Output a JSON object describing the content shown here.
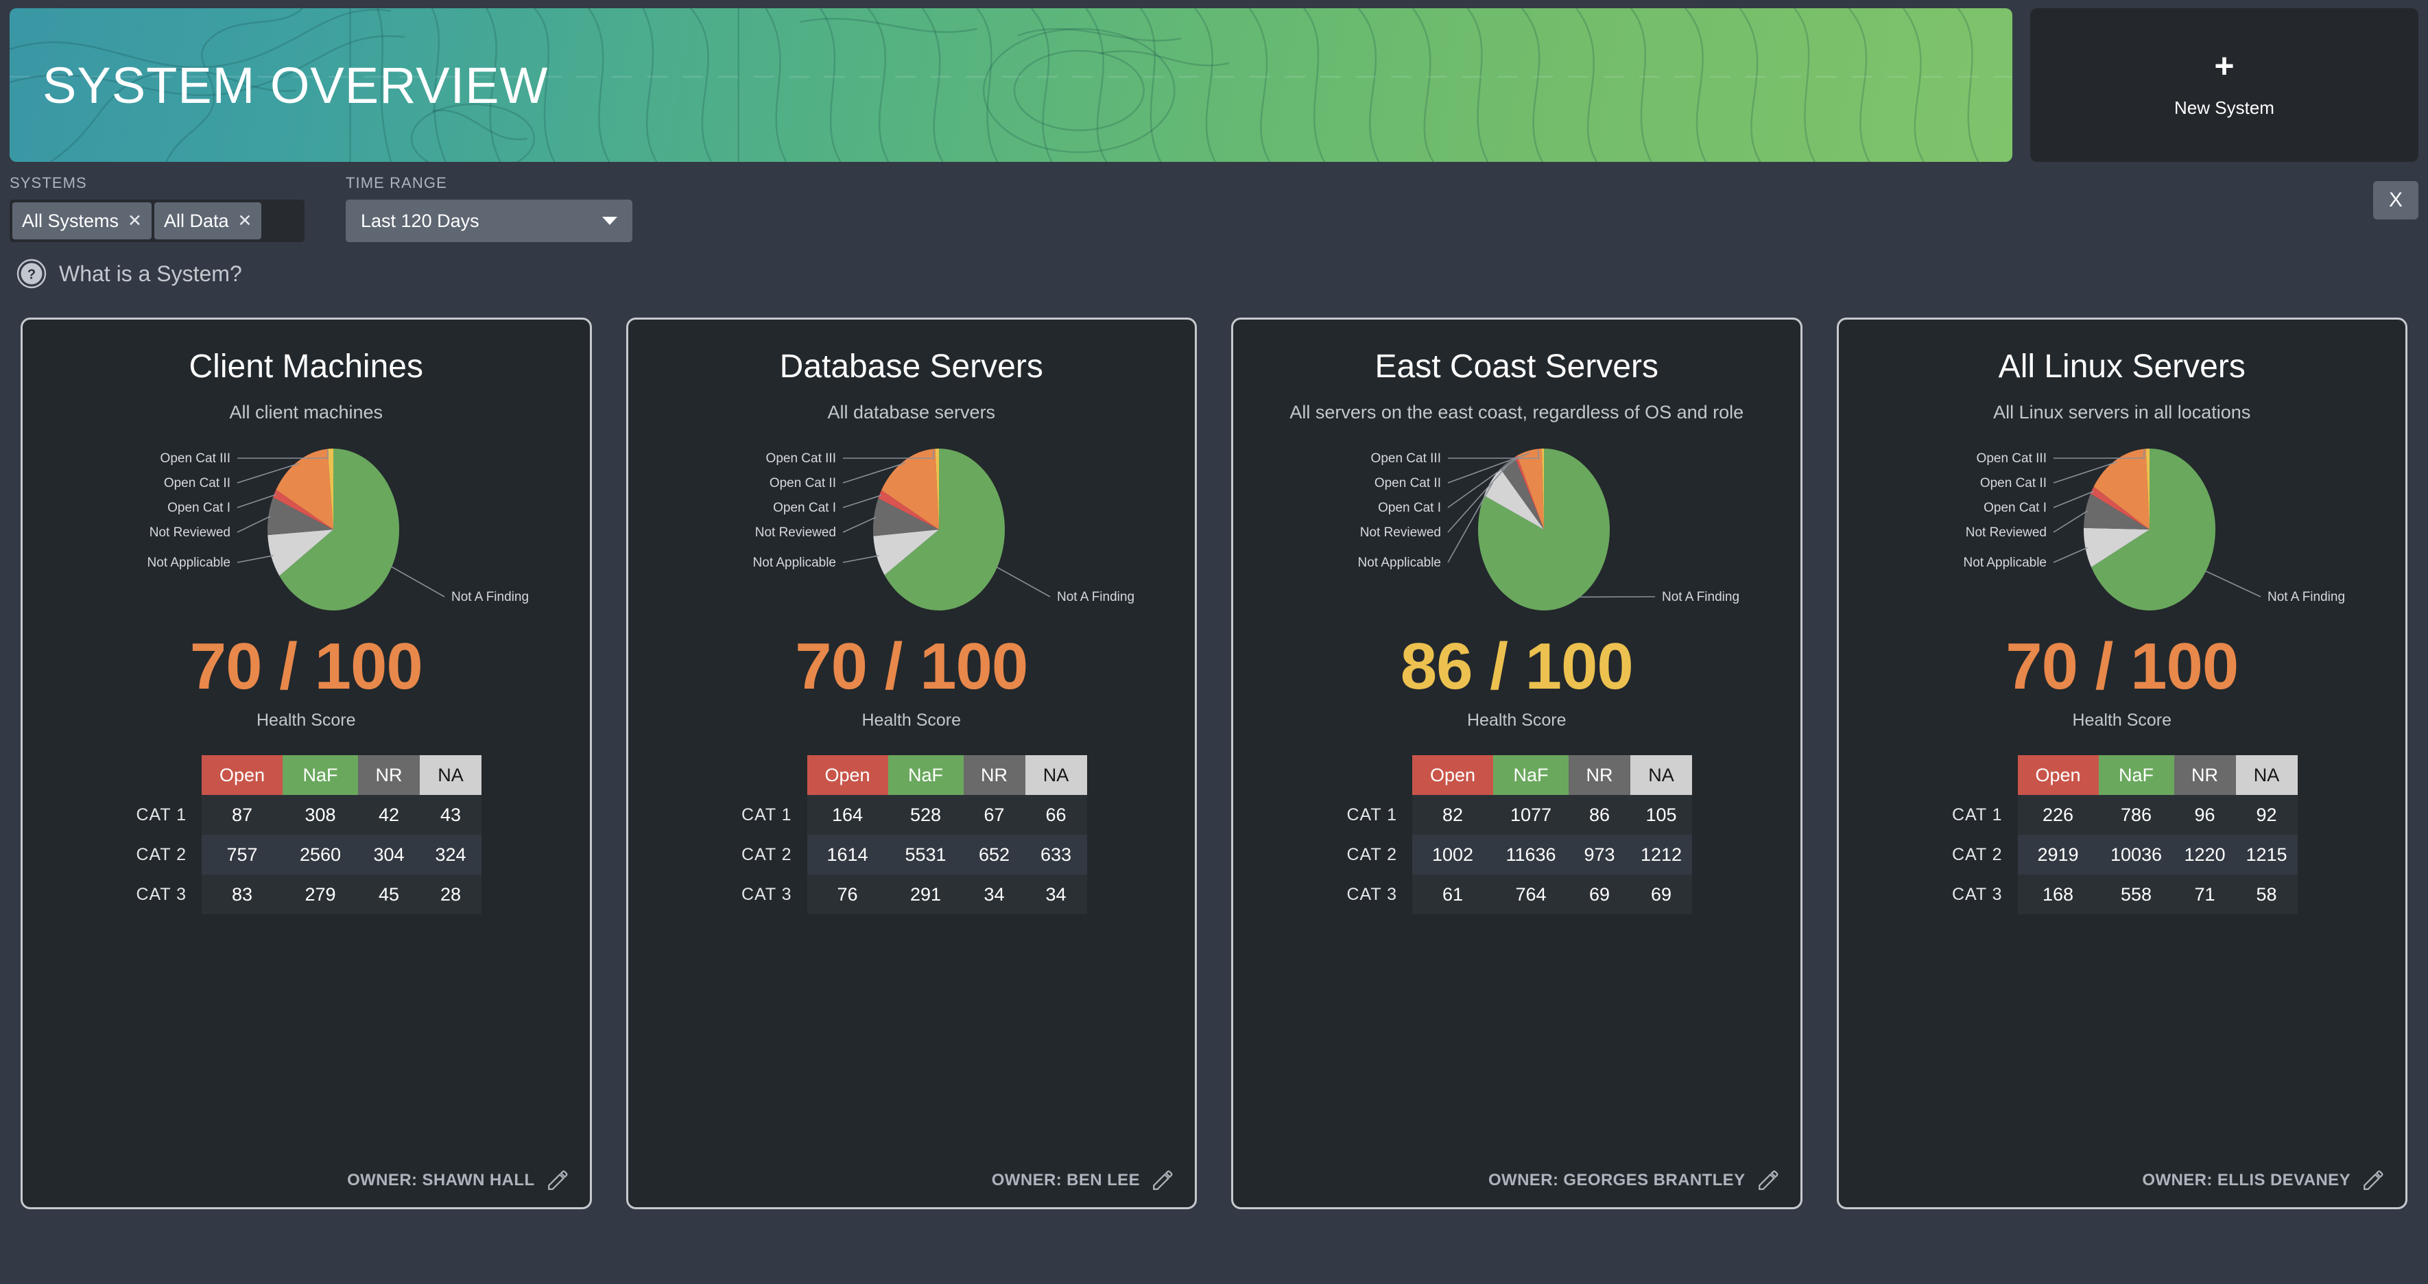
{
  "banner": {
    "title": "SYSTEM OVERVIEW"
  },
  "new_system": {
    "plus": "+",
    "label": "New System"
  },
  "filters": {
    "systems_label": "SYSTEMS",
    "chips": [
      {
        "label": "All Systems",
        "remove": "✕"
      },
      {
        "label": "All Data",
        "remove": "✕"
      }
    ],
    "time_range_label": "TIME RANGE",
    "time_range_value": "Last 120 Days",
    "close_label": "X"
  },
  "help": {
    "icon_glyph": "?",
    "text": "What is a System?"
  },
  "palette": {
    "open": "#c9554a",
    "naf": "#6aa85e",
    "nr": "#6a6a6a",
    "na": "#d0d0d0",
    "cat1": "#edc14f",
    "cat2": "#e8884b",
    "cat3": "#d9534f",
    "score_orange": "#e8884b",
    "score_yellow": "#edc14f"
  },
  "table_headers": [
    "Open",
    "NaF",
    "NR",
    "NA"
  ],
  "row_labels": [
    "CAT  1",
    "CAT  2",
    "CAT  3"
  ],
  "score_caption": "Health Score",
  "owner_prefix": "OWNER: ",
  "cards": [
    {
      "title": "Client Machines",
      "subtitle": "All client machines",
      "score": "70 / 100",
      "score_color": "#e8884b",
      "owner": "OWNER: SHAWN HALL",
      "rows": [
        [
          "87",
          "308",
          "42",
          "43"
        ],
        [
          "757",
          "2560",
          "304",
          "324"
        ],
        [
          "83",
          "279",
          "45",
          "28"
        ]
      ],
      "chart_data": {
        "type": "pie",
        "title": "Client Machines",
        "labels": [
          "Open Cat III",
          "Open Cat II",
          "Open Cat I",
          "Not Reviewed",
          "Not Applicable",
          "Not A Finding"
        ],
        "values": [
          1.4,
          15.4,
          1.7,
          7.6,
          8.6,
          65.3
        ],
        "colors": [
          "#edc14f",
          "#e8884b",
          "#d9534f",
          "#6a6a6a",
          "#d4d4d4",
          "#6aa85e"
        ],
        "legend": "callout-labels"
      }
    },
    {
      "title": "Database Servers",
      "subtitle": "All database servers",
      "score": "70 / 100",
      "score_color": "#e8884b",
      "owner": "OWNER: BEN LEE",
      "rows": [
        [
          "164",
          "528",
          "67",
          "66"
        ],
        [
          "1614",
          "5531",
          "652",
          "633"
        ],
        [
          "76",
          "291",
          "34",
          "34"
        ]
      ],
      "chart_data": {
        "type": "pie",
        "title": "Database Servers",
        "labels": [
          "Open Cat III",
          "Open Cat II",
          "Open Cat I",
          "Not Reviewed",
          "Not Applicable",
          "Not A Finding"
        ],
        "values": [
          0.9,
          16.0,
          1.8,
          7.6,
          8.2,
          65.5
        ],
        "colors": [
          "#edc14f",
          "#e8884b",
          "#d9534f",
          "#6a6a6a",
          "#d4d4d4",
          "#6aa85e"
        ],
        "legend": "callout-labels"
      }
    },
    {
      "title": "East Coast Servers",
      "subtitle": "All servers on the east coast, regardless of OS and role",
      "score": "86 / 100",
      "score_color": "#edc14f",
      "owner": "OWNER: GEORGES BRANTLEY",
      "rows": [
        [
          "82",
          "1077",
          "86",
          "105"
        ],
        [
          "1002",
          "11636",
          "973",
          "1212"
        ],
        [
          "61",
          "764",
          "69",
          "69"
        ]
      ],
      "chart_data": {
        "type": "pie",
        "title": "East Coast Servers",
        "labels": [
          "Open Cat III",
          "Open Cat II",
          "Open Cat I",
          "Not Reviewed",
          "Not Applicable",
          "Not A Finding"
        ],
        "values": [
          0.5,
          6.2,
          0.6,
          4.2,
          6.6,
          81.9
        ],
        "colors": [
          "#edc14f",
          "#e8884b",
          "#d9534f",
          "#6a6a6a",
          "#d4d4d4",
          "#6aa85e"
        ],
        "legend": "callout-labels"
      }
    },
    {
      "title": "All Linux Servers",
      "subtitle": "All Linux servers in all locations",
      "score": "70 / 100",
      "score_color": "#e8884b",
      "owner": "OWNER: ELLIS DEVANEY",
      "rows": [
        [
          "226",
          "786",
          "96",
          "92"
        ],
        [
          "2919",
          "10036",
          "1220",
          "1215"
        ],
        [
          "168",
          "558",
          "71",
          "58"
        ]
      ],
      "chart_data": {
        "type": "pie",
        "title": "All Linux Servers",
        "labels": [
          "Open Cat III",
          "Open Cat II",
          "Open Cat I",
          "Not Reviewed",
          "Not Applicable",
          "Not A Finding"
        ],
        "values": [
          0.9,
          15.2,
          1.6,
          7.0,
          8.0,
          67.3
        ],
        "colors": [
          "#edc14f",
          "#e8884b",
          "#d9534f",
          "#6a6a6a",
          "#d4d4d4",
          "#6aa85e"
        ],
        "legend": "callout-labels"
      }
    }
  ]
}
